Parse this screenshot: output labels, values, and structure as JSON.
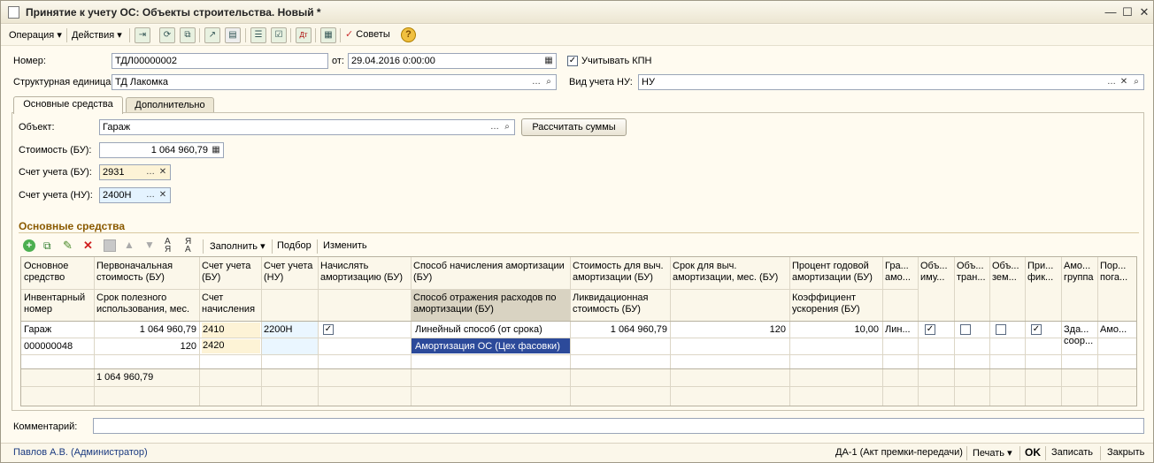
{
  "window": {
    "title": "Принятие к учету ОС: Объекты строительства. Новый *"
  },
  "toolbar": {
    "operation": "Операция",
    "actions": "Действия",
    "advice": "Советы",
    "icons": [
      "post-icon",
      "refresh-icon",
      "copy-icon",
      "export-icon",
      "print-icon",
      "list-icon",
      "checklist-icon",
      "dt-kt-icon",
      "report-icon",
      "advice-icon",
      "help-icon"
    ]
  },
  "header": {
    "number_label": "Номер:",
    "number_value": "ТДЛ00000002",
    "date_label": "от:",
    "date_value": "29.04.2016  0:00:00",
    "kpn_label": "Учитывать КПН",
    "unit_label": "Структурная единица:",
    "unit_value": "ТД Лакомка",
    "nu_label": "Вид учета НУ:",
    "nu_value": "НУ"
  },
  "tabs": [
    {
      "label": "Основные средства"
    },
    {
      "label": "Дополнительно"
    }
  ],
  "form": {
    "object_label": "Объект:",
    "object_value": "Гараж",
    "calc_button": "Рассчитать суммы",
    "cost_label": "Стоимость (БУ):",
    "cost_value": "1 064 960,79",
    "acc_bu_label": "Счет учета (БУ):",
    "acc_bu_value": "2931",
    "acc_nu_label": "Счет учета (НУ):",
    "acc_nu_value": "2400Н"
  },
  "section": {
    "title": "Основные средства",
    "fill": "Заполнить",
    "select": "Подбор",
    "change": "Изменить"
  },
  "grid": {
    "headers": [
      [
        "Основное средство",
        "Инвентарный номер"
      ],
      [
        "Первоначальная стоимость (БУ)",
        "Срок полезного использования, мес."
      ],
      [
        "Счет учета (БУ)",
        "Счет начисления"
      ],
      [
        "Счет учета (НУ)",
        ""
      ],
      [
        "Начислять амортизацию (БУ)",
        ""
      ],
      [
        "Способ начисления амортизации (БУ)",
        "Способ отражения расходов по амортизации (БУ)"
      ],
      [
        "Стоимость для выч. амортизации (БУ)",
        "Ликвидационная стоимость (БУ)"
      ],
      [
        "Срок для выч. амортизации, мес. (БУ)",
        ""
      ],
      [
        "Процент годовой амортизации (БУ)",
        "Коэффициент ускорения (БУ)"
      ],
      [
        "Гра... амо...",
        ""
      ],
      [
        "Объ... иму...",
        ""
      ],
      [
        "Объ... тран...",
        ""
      ],
      [
        "Объ... зем...",
        ""
      ],
      [
        "При... фик...",
        ""
      ],
      [
        "Амо... группа",
        ""
      ],
      [
        "Пор... пога...",
        ""
      ]
    ],
    "row": {
      "name": "Гараж",
      "inv": "000000048",
      "cost": "1 064 960,79",
      "term": "120",
      "acc_bu": "2410",
      "acc_charge": "2420",
      "acc_nu": "2200Н",
      "method": "Линейный способ (от срока)",
      "reflect": "Амортизация ОС (Цех фасовки)",
      "amort_cost": "1 064 960,79",
      "months": "120",
      "percent": "10,00",
      "graph": "Лин...",
      "group": "Зда... соор...",
      "order": "Амо..."
    },
    "total": "1 064 960,79"
  },
  "comment": {
    "label": "Комментарий:",
    "value": ""
  },
  "status": {
    "user": "Павлов А.В. (Администратор)",
    "doc": "ДА-1 (Акт премки-передачи)",
    "print": "Печать",
    "ok": "OK",
    "save": "Записать",
    "close": "Закрыть"
  }
}
